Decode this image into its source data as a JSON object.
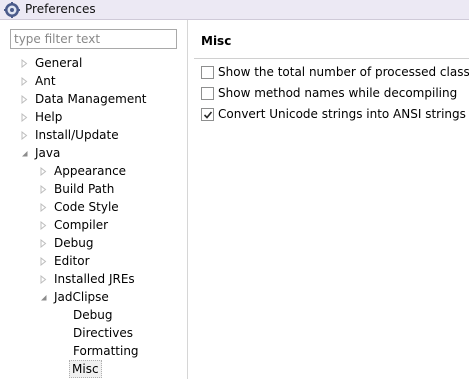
{
  "window": {
    "title": "Preferences"
  },
  "filter": {
    "placeholder": "type filter text",
    "value": ""
  },
  "tree": {
    "general": "General",
    "ant": "Ant",
    "data_management": "Data Management",
    "help": "Help",
    "install_update": "Install/Update",
    "java": "Java",
    "appearance": "Appearance",
    "build_path": "Build Path",
    "code_style": "Code Style",
    "compiler": "Compiler",
    "debug": "Debug",
    "editor": "Editor",
    "installed_jres": "Installed JREs",
    "jadclipse": "JadClipse",
    "jad_debug": "Debug",
    "jad_directives": "Directives",
    "jad_formatting": "Formatting",
    "jad_misc": "Misc"
  },
  "page": {
    "title": "Misc",
    "options": [
      {
        "label": "Show the total number of processed classes/m",
        "checked": false
      },
      {
        "label": "Show method names while decompiling",
        "checked": false
      },
      {
        "label": "Convert Unicode strings into ANSI strings",
        "checked": true
      }
    ]
  },
  "colors": {
    "titlebar": "#ece9f4",
    "twisty": "#bdbdbd",
    "twisty_expanded": "#8c8c8c",
    "check": "#2a2a2a"
  }
}
